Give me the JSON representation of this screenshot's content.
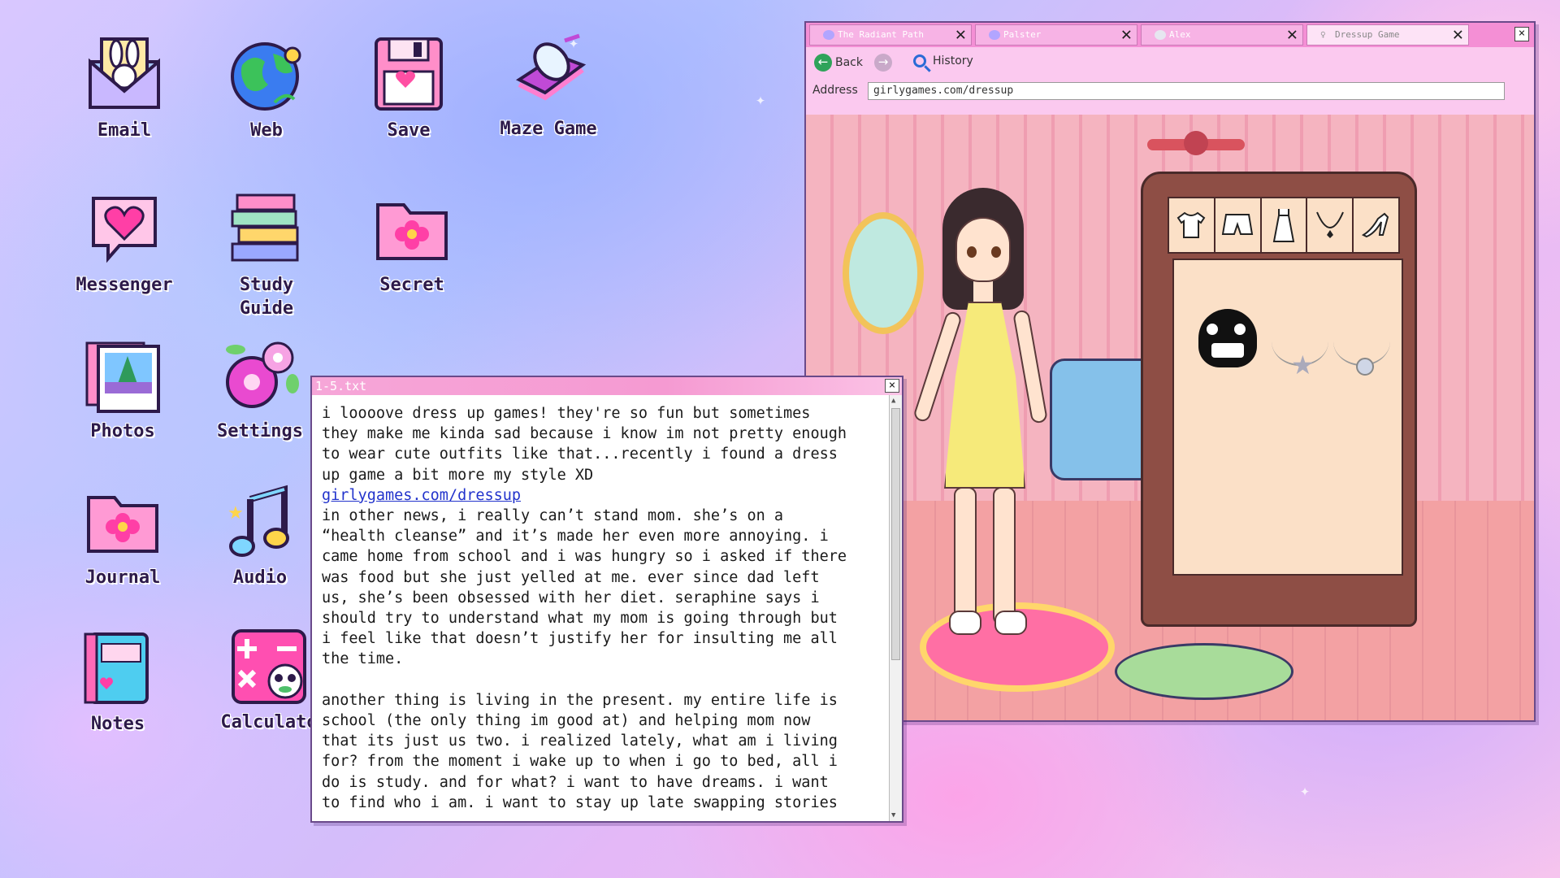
{
  "desktop": {
    "icons": [
      {
        "label": "Email"
      },
      {
        "label": "Web"
      },
      {
        "label": "Save"
      },
      {
        "label": "Maze Game"
      },
      {
        "label": "Messenger"
      },
      {
        "label": "Study\nGuide"
      },
      {
        "label": "Secret"
      },
      {
        "label": "Photos"
      },
      {
        "label": "Settings"
      },
      {
        "label": "Journal"
      },
      {
        "label": "Audio"
      },
      {
        "label": "Notes"
      },
      {
        "label": "Calculato"
      }
    ]
  },
  "text_window": {
    "title": "1-5.txt",
    "close": "×",
    "para1": "i loooove dress up games! they're so fun but sometimes\nthey make me kinda sad because i know im not pretty enough\nto wear cute outfits like that...recently i found a dress\nup game a bit more my style XD\n",
    "link": "girlygames.com/dressup",
    "para2": "\nin other news, i really can’t stand mom. she’s on a\n“health cleanse” and it’s made her even more annoying. i\ncame home from school and i was hungry so i asked if there\nwas food but she just yelled at me. ever since dad left\nus, she’s been obsessed with her diet. seraphine says i\nshould try to understand what my mom is going through but\ni feel like that doesn’t justify her for insulting me all\nthe time.\n\nanother thing is living in the present. my entire life is\nschool (the only thing im good at) and helping mom now\nthat its just us two. i realized lately, what am i living\nfor? from the moment i wake up to when i go to bed, all i\ndo is study. and for what? i want to have dreams. i want\nto find who i am. i want to stay up late swapping stories"
  },
  "browser": {
    "tabs": [
      {
        "label": "The Radiant Path",
        "active": false
      },
      {
        "label": "Palster",
        "active": false
      },
      {
        "label": "Alex",
        "active": false
      },
      {
        "label": "Dressup Game",
        "active": true
      }
    ],
    "tab_close": "✕",
    "window_close": "×",
    "nav": {
      "back": "Back",
      "history": "History"
    },
    "address_label": "Address",
    "address_value": "girlygames.com/dressup"
  },
  "game": {
    "categories": [
      {
        "icon": "shirt-icon",
        "glyph": "👕"
      },
      {
        "icon": "shorts-icon",
        "glyph": "▭"
      },
      {
        "icon": "dress-icon",
        "glyph": "♀"
      },
      {
        "icon": "necklace-icon",
        "glyph": "∨"
      },
      {
        "icon": "heel-icon",
        "glyph": "⌐"
      }
    ]
  }
}
